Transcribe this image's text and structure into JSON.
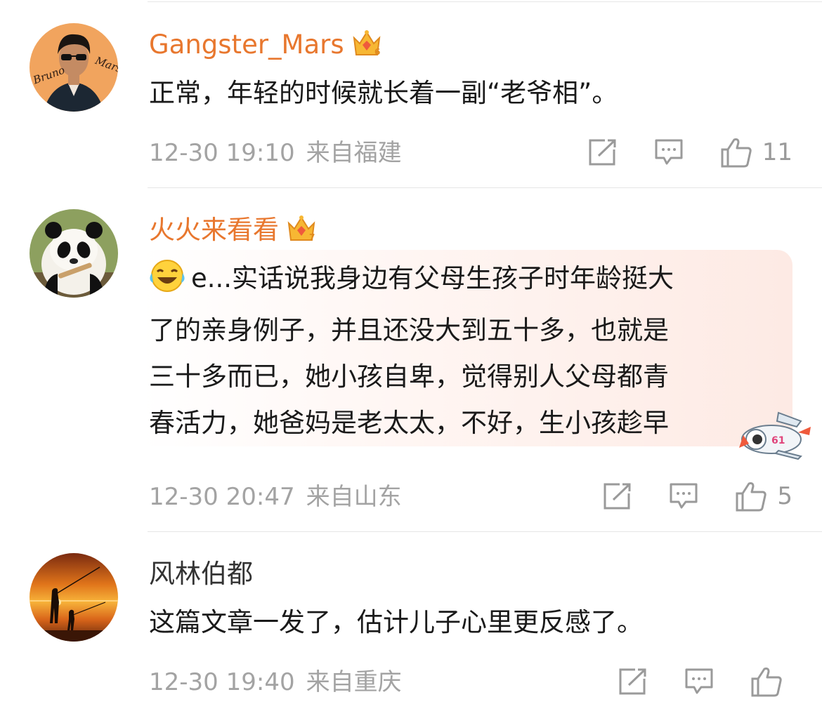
{
  "comments": [
    {
      "username": "Gangster_Mars",
      "badge_level": "6",
      "text": "正常，年轻的时候就长着一副“老爷相”。",
      "time": "12-30 19:10",
      "source": "来自福建",
      "likes": "11",
      "avatar_text": {
        "line1": "Bruno",
        "line2": "Mars"
      }
    },
    {
      "username": "火火来看看",
      "badge_level": "7",
      "emoji": "laugh-cry",
      "text_lines": [
        "e...实话说我身边有父母生孩子时年龄挺大",
        "了的亲身例子，并且还没大到五十多，也就是",
        "三十多而已，她小孩自卑，觉得别人父母都青",
        "春活力，她爸妈是老太太，不好，生小孩趁早"
      ],
      "sticker_number": "61",
      "time": "12-30 20:47",
      "source": "来自山东",
      "likes": "5"
    },
    {
      "username": "风林伯都",
      "text": "这篇文章一发了，估计儿子心里更反感了。",
      "time": "12-30 19:40",
      "source": "来自重庆",
      "likes": ""
    }
  ],
  "colors": {
    "vip_name": "#e8772e",
    "meta": "#a3a3a3",
    "icon": "#9a9a9a"
  }
}
